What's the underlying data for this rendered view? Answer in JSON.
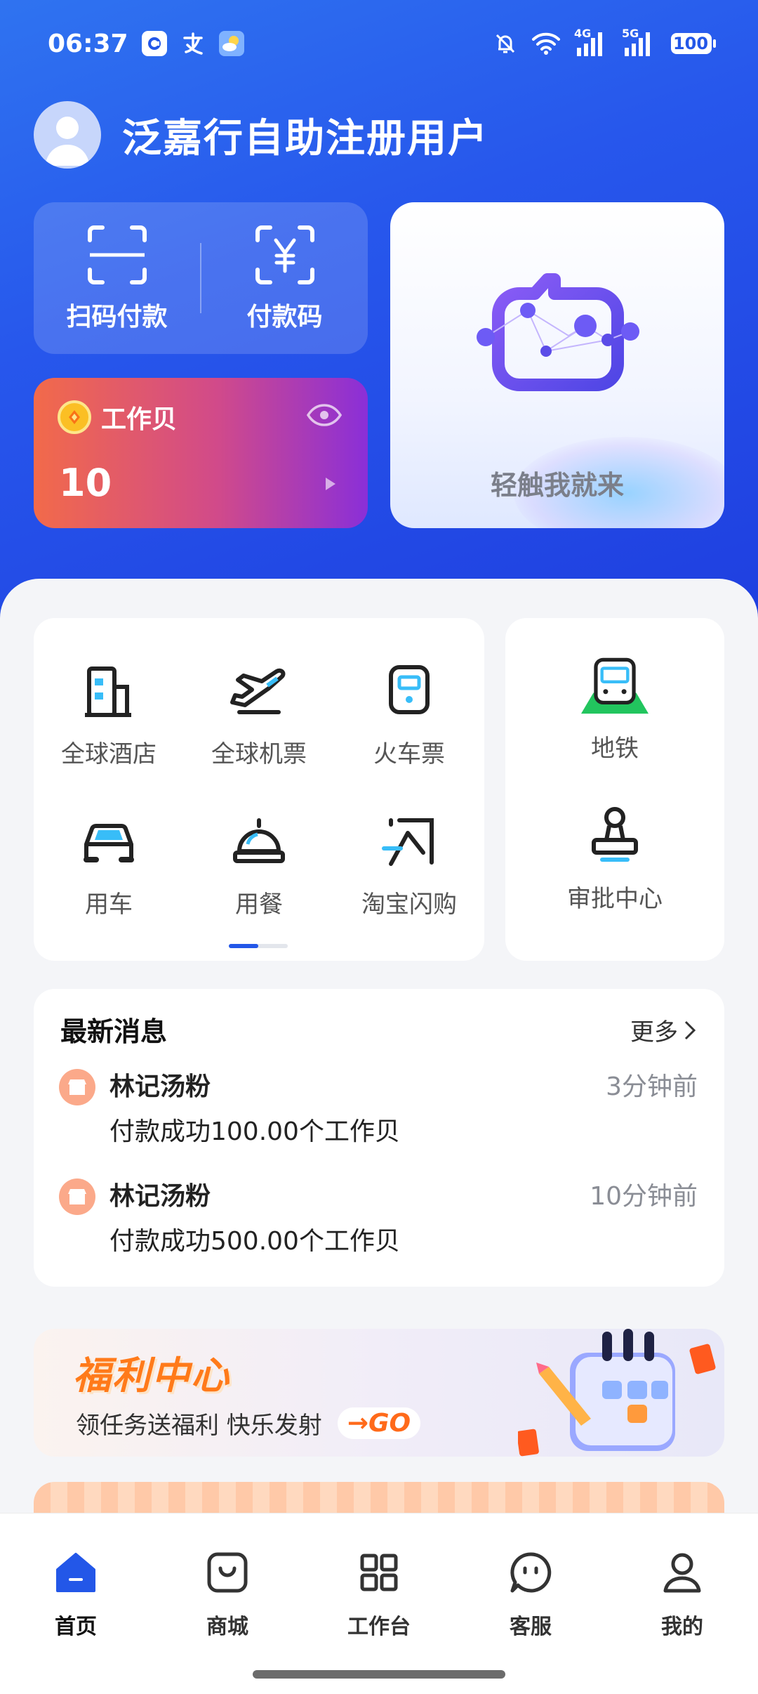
{
  "status_bar": {
    "time": "06:37",
    "network_4g": "4G",
    "network_5g": "5G",
    "battery": "100"
  },
  "user": {
    "name": "泛嘉行自助注册用户"
  },
  "payment": {
    "scan_label": "扫码付款",
    "code_label": "付款码"
  },
  "wallet": {
    "title": "工作贝",
    "balance": "10"
  },
  "assistant": {
    "label": "轻触我就来"
  },
  "services": {
    "grid": [
      {
        "label": "全球酒店",
        "icon": "hotel-icon"
      },
      {
        "label": "全球机票",
        "icon": "airplane-icon"
      },
      {
        "label": "火车票",
        "icon": "train-icon"
      },
      {
        "label": "用车",
        "icon": "car-icon"
      },
      {
        "label": "用餐",
        "icon": "dining-icon"
      },
      {
        "label": "淘宝闪购",
        "icon": "flash-buy-icon"
      }
    ],
    "side": [
      {
        "label": "地铁",
        "icon": "subway-icon"
      },
      {
        "label": "审批中心",
        "icon": "approval-stamp-icon"
      }
    ],
    "page_count": 2,
    "active_page": 1
  },
  "news": {
    "title": "最新消息",
    "more": "更多",
    "items": [
      {
        "shop": "林记汤粉",
        "time": "3分钟前",
        "message": "付款成功100.00个工作贝"
      },
      {
        "shop": "林记汤粉",
        "time": "10分钟前",
        "message": "付款成功500.00个工作贝"
      }
    ]
  },
  "banner": {
    "title": "福利中心",
    "subtitle": "领任务送福利 快乐发射",
    "go": "→GO"
  },
  "tabs": [
    {
      "label": "首页",
      "icon": "home-icon",
      "active": true
    },
    {
      "label": "商城",
      "icon": "shop-bag-icon"
    },
    {
      "label": "工作台",
      "icon": "workbench-grid-icon"
    },
    {
      "label": "客服",
      "icon": "customer-service-icon"
    },
    {
      "label": "我的",
      "icon": "profile-icon"
    }
  ],
  "colors": {
    "primary": "#2357e8",
    "header_top": "#2f73f0",
    "header_bottom": "#1f3fe0",
    "accent_orange": "#ff7a1a",
    "text_gray": "#8a8d95"
  }
}
